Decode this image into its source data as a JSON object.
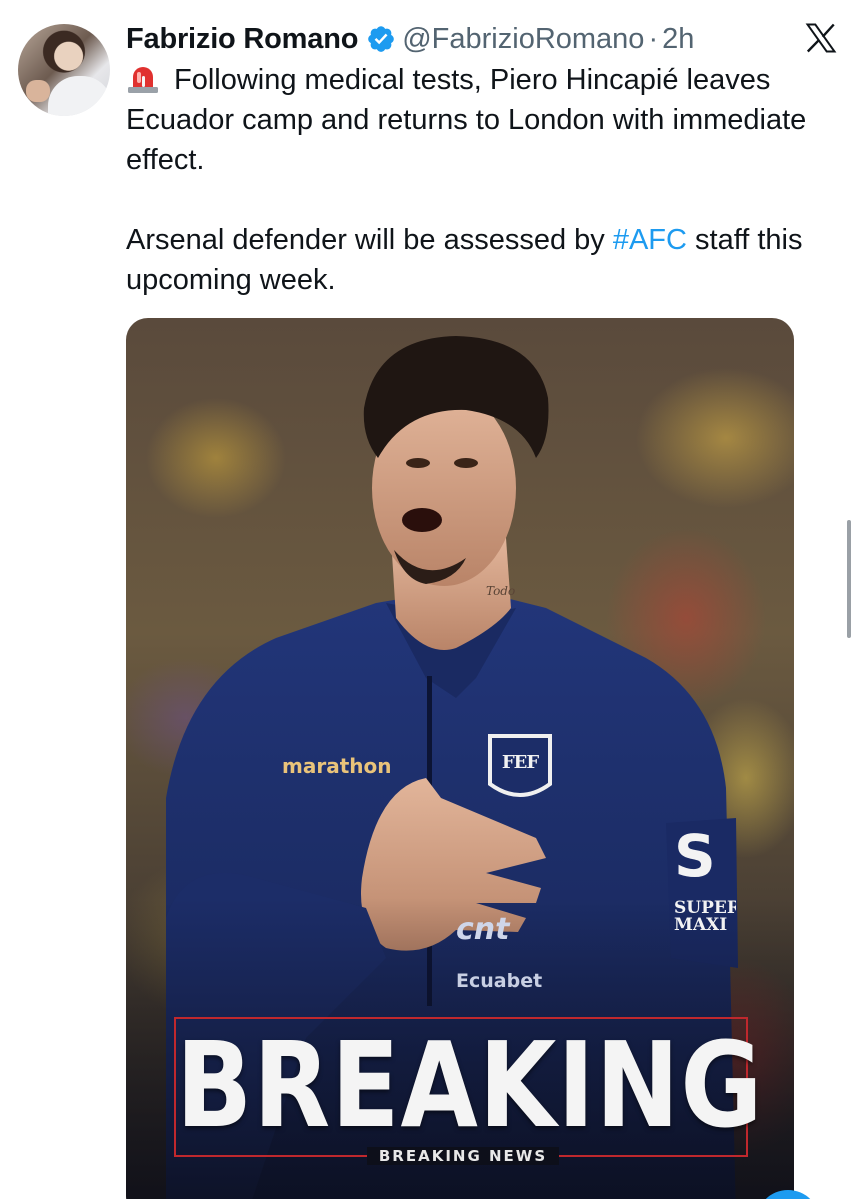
{
  "author": {
    "name": "Fabrizio Romano",
    "handle": "@FabrizioRomano",
    "separator": "·",
    "time": "2h",
    "verified": true
  },
  "tweet": {
    "siren_icon": "rotating-light-emoji",
    "line1": "Following medical tests, Piero Hincapié leaves Ecuador camp and returns to London with immediate effect.",
    "line2_before": "Arsenal defender will be assessed by ",
    "hashtag": "#AFC",
    "line2_after": " staff this upcoming week."
  },
  "media": {
    "kit_brand": "marathon",
    "sponsor1": "cnt",
    "sponsor2": "Ecuabet",
    "sleeve_logo": "SUPER MAXI",
    "sleeve_logo_letter": "S",
    "crest_text": "FEF",
    "neck_tattoo": "Todo",
    "headline": "BREAKING",
    "subheadline": "BREAKING NEWS"
  },
  "colors": {
    "link": "#1d9bf0",
    "secondary_text": "#536471",
    "verified": "#1d9bf0",
    "breaking_frame": "#c0282d",
    "jersey": "#1d2f6e"
  },
  "icons": {
    "verified": "verified-badge-icon",
    "platform": "x-logo-icon"
  }
}
